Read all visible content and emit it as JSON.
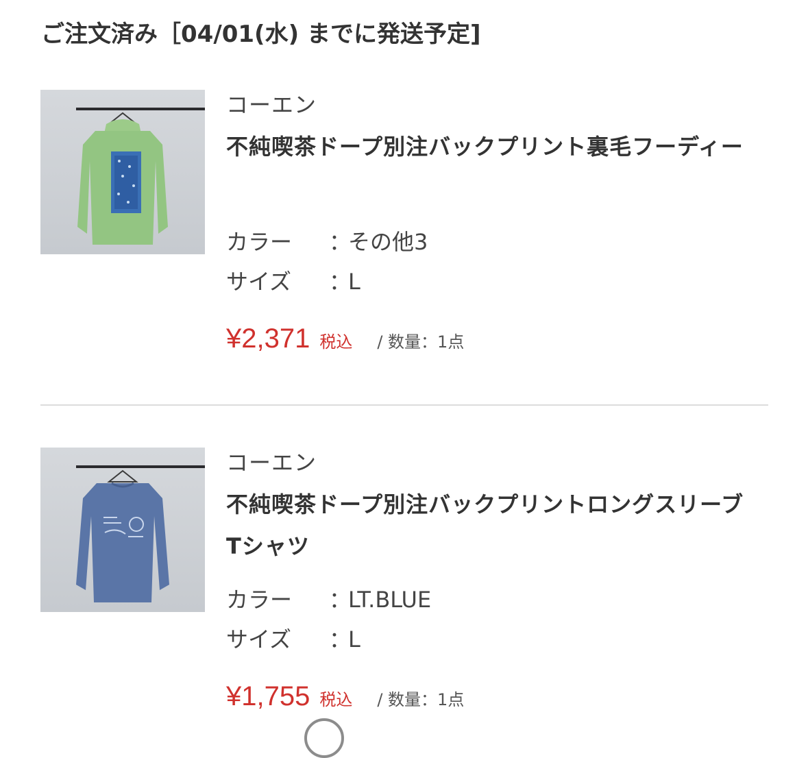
{
  "header": {
    "title": "ご注文済み［04/01(水) までに発送予定]"
  },
  "items": [
    {
      "brand": "コーエン",
      "title": "不純喫茶ドープ別注バックプリント裏毛フーディー",
      "color_label": "カラー",
      "color_value": "その他3",
      "size_label": "サイズ",
      "size_value": "L",
      "colon": "：",
      "price": "¥2,371",
      "tax": "税込",
      "quantity": "/ 数量：1点",
      "image": "green-hoodie-image",
      "garment_color": "#8fbf7e"
    },
    {
      "brand": "コーエン",
      "title": "不純喫茶ドープ別注バックプリントロングスリーブTシャツ",
      "color_label": "カラー",
      "color_value": "LT.BLUE",
      "size_label": "サイズ",
      "size_value": "L",
      "colon": "：",
      "price": "¥1,755",
      "tax": "税込",
      "quantity": "/ 数量：1点",
      "image": "blue-longsleeve-image",
      "garment_color": "#5b76a8"
    }
  ],
  "colors": {
    "price": "#d0312d",
    "text": "#333333",
    "divider": "#dcdcdc"
  }
}
